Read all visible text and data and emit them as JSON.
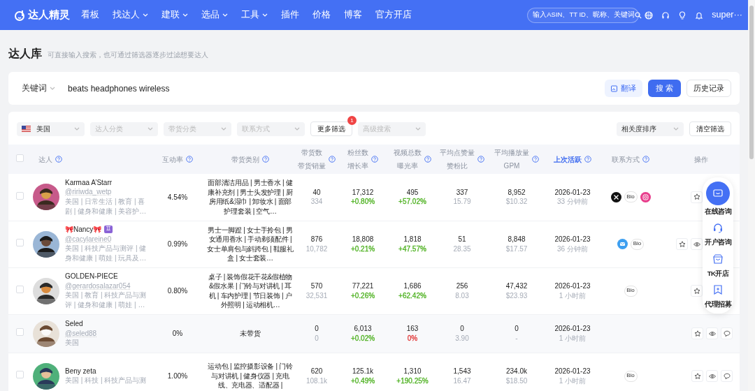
{
  "brand": "达人精灵",
  "nav": [
    {
      "label": "看板",
      "dropdown": false
    },
    {
      "label": "找达人",
      "dropdown": true
    },
    {
      "label": "建联",
      "dropdown": true
    },
    {
      "label": "选品",
      "dropdown": true
    },
    {
      "label": "工具",
      "dropdown": true
    },
    {
      "label": "插件",
      "dropdown": false
    },
    {
      "label": "价格",
      "dropdown": false
    },
    {
      "label": "博客",
      "dropdown": false
    },
    {
      "label": "官方开店",
      "dropdown": false
    }
  ],
  "global_search": {
    "placeholder": "输入ASIN、TT ID、昵称、关键词"
  },
  "user": "super···",
  "page": {
    "title": "达人库",
    "subtitle": "可直接输入搜索，也可通过筛选器逐步过滤想要达人"
  },
  "search": {
    "mode": "关键词",
    "value": "beats headphones wireless",
    "buttons": [
      {
        "label": "翻译",
        "kind": "translate"
      },
      {
        "label": "搜 索",
        "kind": "primary"
      },
      {
        "label": "历史记录",
        "kind": "plain"
      }
    ]
  },
  "filters": [
    {
      "kind": "select",
      "value": "美国",
      "flag": true
    },
    {
      "kind": "select",
      "placeholder": "达人分类"
    },
    {
      "kind": "select",
      "placeholder": "带货分类"
    },
    {
      "kind": "select",
      "placeholder": "联系方式"
    },
    {
      "kind": "button",
      "label": "更多筛选",
      "count": "1"
    },
    {
      "kind": "select",
      "placeholder": "高级搜索"
    }
  ],
  "sort": {
    "value": "相关度排序"
  },
  "clear_button": "清空筛选",
  "all_checked": false,
  "columns": [
    {
      "lines": [
        "达人"
      ],
      "help": true,
      "sorted": false
    },
    {
      "lines": [
        "互动率"
      ],
      "help": true,
      "sorted": false
    },
    {
      "lines": [
        "带货类别"
      ],
      "help": true,
      "sorted": false
    },
    {
      "lines": [
        "带货数",
        "带货销量"
      ],
      "help": true,
      "sorted": false
    },
    {
      "lines": [
        "粉丝数",
        "增长率"
      ],
      "help": true,
      "sorted": false
    },
    {
      "lines": [
        "视频总数",
        "曝光率"
      ],
      "help": true,
      "sorted": false
    },
    {
      "lines": [
        "平均点赞量",
        "赞粉比"
      ],
      "help": true,
      "sorted": false
    },
    {
      "lines": [
        "平均播放量",
        "GPM"
      ],
      "help": true,
      "sorted": false
    },
    {
      "lines": [
        "上次活跃"
      ],
      "help": true,
      "sorted": true
    },
    {
      "lines": [
        "联系方式"
      ],
      "help": true,
      "sorted": false
    },
    {
      "lines": [
        "操作"
      ],
      "help": false,
      "sorted": false
    }
  ],
  "rows": [
    {
      "checked": false,
      "name": "Karmaa A’Starr",
      "handle": "@ririwda_wetp",
      "tags": "美国 | 日常生活 | 教育 | 喜剧 | 健身和健康 | 美容护…",
      "engagement": "4.54%",
      "categories": "面部清洁用品 | 男士香水 | 健康补充剂 | 男士头发护理 | 厨房用纸&湿巾 | 卸妆水 | 面部护理套装 | 空气…",
      "goods": "40",
      "sales": "334",
      "fans": "17,312",
      "fans_growth": {
        "text": "+0.80%",
        "color": "#52b326"
      },
      "videos": "495",
      "exposure": {
        "text": "+57.02%",
        "color": "#52b326"
      },
      "likes": "337",
      "like_ratio": "15.79",
      "plays": "8,952",
      "gpm": "$10.32",
      "active_date": "2026-01-23",
      "active_ago": "33 分钟前",
      "contacts": [
        {
          "kind": "x"
        },
        {
          "kind": "bio",
          "label": "Bio"
        },
        {
          "kind": "instagram"
        }
      ],
      "actions": [
        {
          "kind": "star"
        }
      ]
    },
    {
      "checked": false,
      "name": "🎀Nancy🎀",
      "zodiac": "♊",
      "handle": "@cacylareine0",
      "tags": "美国 | 科技产品与测评 | 健身和健康 | 萌娃 | 玩具及…",
      "engagement": "0.99%",
      "categories": "男士一脚蹬 | 女士手拎包 | 男女通用香水 | 手动剃须配件 | 女士单肩包与斜跨包 | 鞋服礼盒 | 女士套装…",
      "goods": "876",
      "sales": "10,782",
      "fans": "18,808",
      "fans_growth": {
        "text": "+0.21%",
        "color": "#52b326"
      },
      "videos": "1,818",
      "exposure": {
        "text": "+47.57%",
        "color": "#52b326"
      },
      "likes": "51",
      "like_ratio": "28.35",
      "plays": "8,848",
      "gpm": "$17.57",
      "active_date": "2026-01-23",
      "active_ago": "36 分钟前",
      "contacts": [
        {
          "kind": "email"
        },
        {
          "kind": "bio",
          "label": "Bio"
        }
      ],
      "actions": [
        {
          "kind": "star"
        },
        {
          "kind": "eye"
        }
      ]
    },
    {
      "checked": false,
      "name": "GOLDEN-PIECE",
      "handle": "@gerardosalazar054",
      "tags": "美国 | 教育 | 科技产品与测评 | 健身和健康 | 萌娃 | …",
      "engagement": "0.80%",
      "categories": "桌子 | 装饰假花干花&假植物&假水果 | 门铃与对讲机 | 耳机 | 车内护理 | 节日装饰 | 户外照明 | 运动相机…",
      "goods": "570",
      "sales": "32,531",
      "fans": "77,221",
      "fans_growth": {
        "text": "+0.26%",
        "color": "#52b326"
      },
      "videos": "1,686",
      "exposure": {
        "text": "+62.42%",
        "color": "#52b326"
      },
      "likes": "256",
      "like_ratio": "8.03",
      "plays": "47,432",
      "gpm": "$23.93",
      "active_date": "2026-01-23",
      "active_ago": "1 小时前",
      "contacts": [
        {
          "kind": "bio",
          "label": "Bio"
        }
      ],
      "actions": [
        {
          "kind": "star"
        }
      ]
    },
    {
      "checked": false,
      "name": "Seled",
      "handle": "@seled88",
      "tags": "美国",
      "engagement": "0%",
      "categories": "未带货",
      "goods": "0",
      "sales": "0",
      "fans": "6,013",
      "fans_growth": {
        "text": "+0.02%",
        "color": "#52b326"
      },
      "videos": "163",
      "exposure": {
        "text": "0%",
        "color": "#e23b3b"
      },
      "likes": "0",
      "like_ratio": "3.90",
      "plays": "0",
      "gpm": "-",
      "active_date": "2026-01-23",
      "active_ago": "1 小时前",
      "contacts": [],
      "actions": [
        {
          "kind": "star"
        },
        {
          "kind": "eye"
        },
        {
          "kind": "chat"
        }
      ]
    },
    {
      "checked": false,
      "name": "Beny zeta",
      "tags": "美国 | 科技 | 科技产品与测",
      "engagement": "1.00%",
      "categories": "运动包 | 监控摄影设备 | 门铃与对讲机 | 健身仪器 | 充电线、充电器、适配器 |",
      "goods": "620",
      "sales": "108.1k",
      "fans": "125.1k",
      "fans_growth": {
        "text": "+0.49%",
        "color": "#52b326"
      },
      "videos": "1,310",
      "exposure": {
        "text": "+190.25%",
        "color": "#52b326"
      },
      "likes": "1,543",
      "like_ratio": "16.47",
      "plays": "234.0k",
      "gpm": "$18.50",
      "active_date": "2026-01-23",
      "active_ago": "1 小时前",
      "contacts": [
        {
          "kind": "bio",
          "label": "Bio"
        }
      ],
      "actions": [
        {
          "kind": "star"
        },
        {
          "kind": "eye"
        },
        {
          "kind": "chat"
        }
      ]
    }
  ],
  "float_panel": [
    {
      "label": "在线咨询",
      "kind": "chat",
      "selected": true
    },
    {
      "label": "开户咨询",
      "kind": "headset",
      "selected": false
    },
    {
      "label": "TK开店",
      "kind": "bag",
      "selected": false
    },
    {
      "label": "代理招募",
      "kind": "bookmark",
      "selected": false
    }
  ]
}
